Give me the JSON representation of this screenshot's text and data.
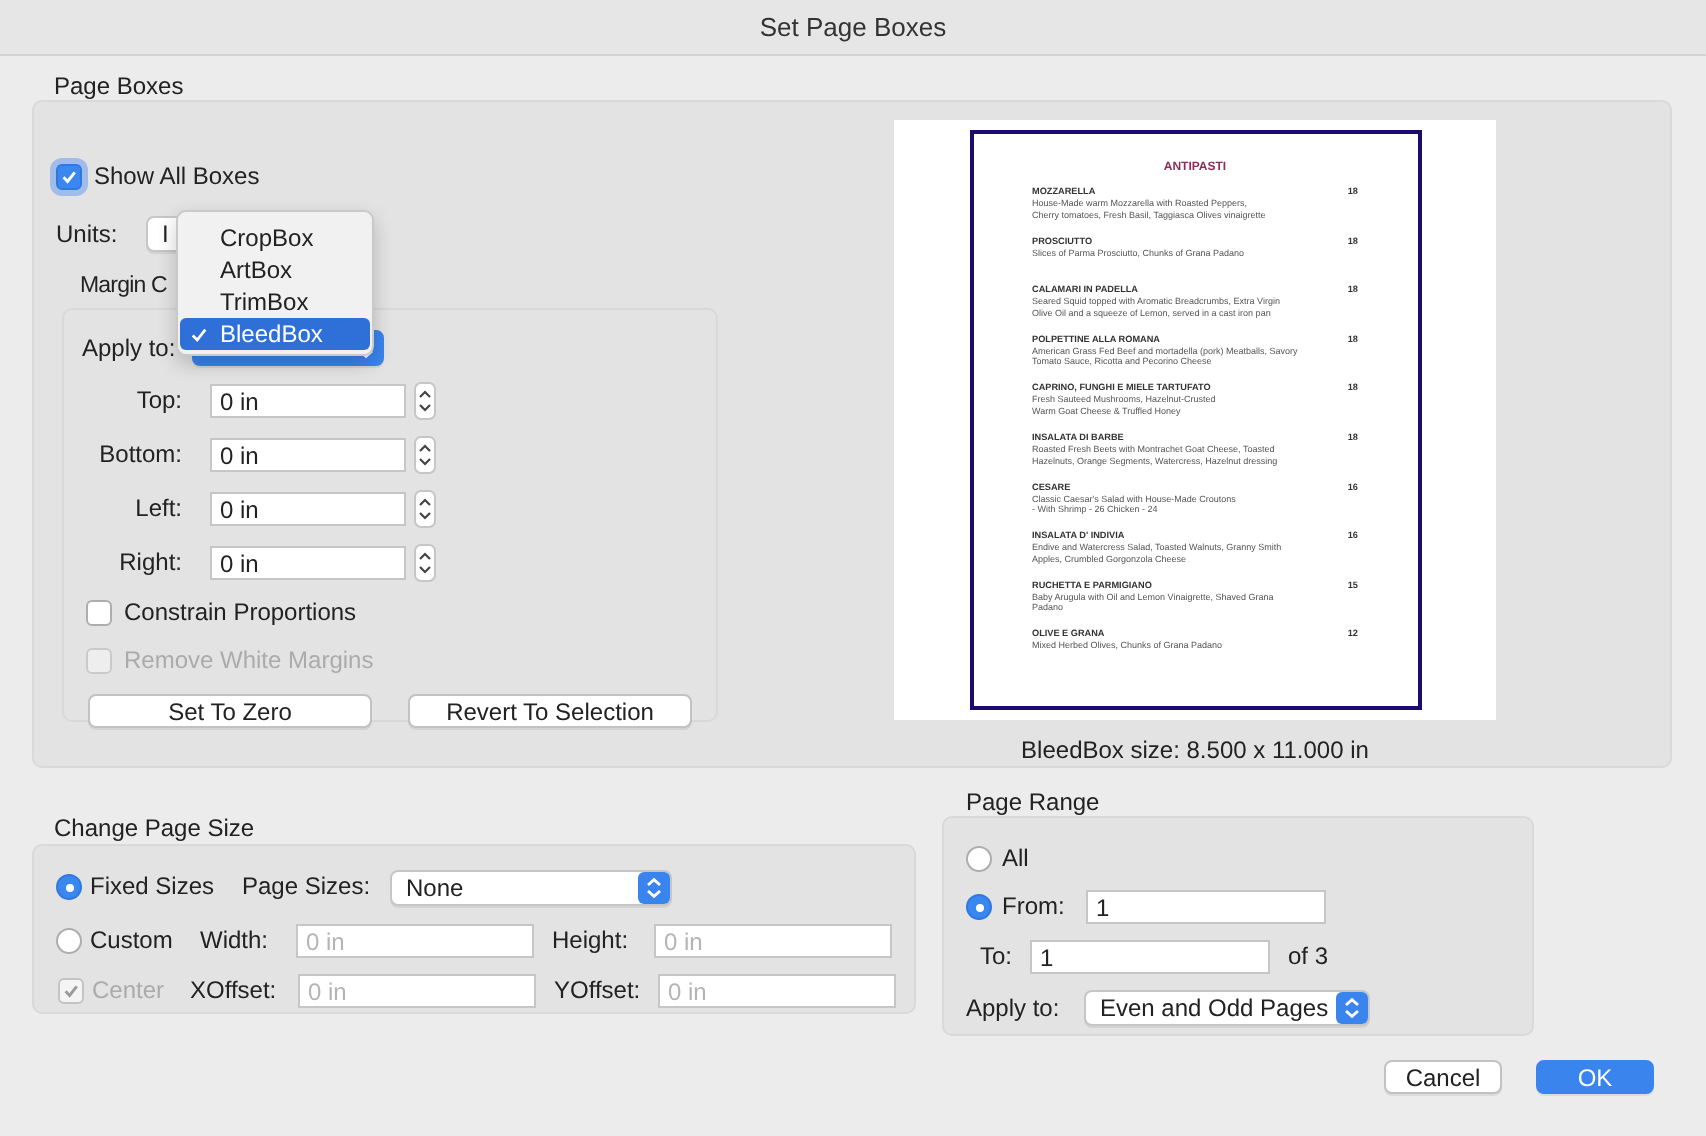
{
  "window": {
    "title": "Set Page Boxes"
  },
  "page_boxes": {
    "label": "Page Boxes",
    "show_all_boxes": {
      "label": "Show All Boxes",
      "checked": true
    },
    "units": {
      "label": "Units:",
      "value": "I"
    },
    "box_menu": {
      "items": [
        {
          "label": "CropBox",
          "selected": false
        },
        {
          "label": "ArtBox",
          "selected": false
        },
        {
          "label": "TrimBox",
          "selected": false
        },
        {
          "label": "BleedBox",
          "selected": true
        }
      ]
    },
    "margin_controls": {
      "label": "Margin C",
      "apply_to_label": "Apply to:",
      "fields": [
        {
          "label": "Top:",
          "value": "0 in"
        },
        {
          "label": "Bottom:",
          "value": "0 in"
        },
        {
          "label": "Left:",
          "value": "0 in"
        },
        {
          "label": "Right:",
          "value": "0 in"
        }
      ],
      "constrain_proportions": {
        "label": "Constrain Proportions",
        "checked": false,
        "disabled": false
      },
      "remove_white_margins": {
        "label": "Remove White Margins",
        "checked": false,
        "disabled": true
      },
      "buttons": [
        "Set To Zero",
        "Revert To Selection"
      ]
    },
    "preview": {
      "heading": "ANTIPASTI",
      "items": [
        {
          "name": "MOZZARELLA",
          "price": "18",
          "description": [
            "House-Made warm Mozzarella with Roasted Peppers,",
            "Cherry tomatoes, Fresh Basil, Taggiasca Olives vinaigrette"
          ]
        },
        {
          "name": "PROSCIUTTO",
          "price": "18",
          "description": [
            "Slices of Parma Prosciutto, Chunks of Grana Padano"
          ]
        },
        {
          "name": "CALAMARI IN PADELLA",
          "price": "18",
          "description": [
            "Seared Squid topped with Aromatic Breadcrumbs, Extra Virgin",
            "Olive Oil and a squeeze of Lemon, served in a cast iron pan"
          ]
        },
        {
          "name": "POLPETTINE ALLA ROMANA",
          "price": "18",
          "description": [
            "American Grass Fed Beef and mortadella (pork) Meatballs, Savory",
            "Tomato Sauce, Ricotta and Pecorino Cheese"
          ]
        },
        {
          "name": "CAPRINO, FUNGHI E MIELE TARTUFATO",
          "price": "18",
          "description": [
            "Fresh Sauteed Mushrooms, Hazelnut-Crusted",
            "Warm Goat Cheese & Truffled Honey"
          ]
        },
        {
          "name": "INSALATA DI BARBE",
          "price": "18",
          "description": [
            "Roasted Fresh Beets with Montrachet Goat Cheese, Toasted",
            "Hazelnuts, Orange Segments, Watercress, Hazelnut dressing"
          ]
        },
        {
          "name": "CESARE",
          "price": "16",
          "description": [
            "Classic Caesar's Salad with House-Made Croutons",
            "- With Shrimp - 26     Chicken - 24"
          ]
        },
        {
          "name": "INSALATA D' INDIVIA",
          "price": "16",
          "description": [
            "Endive and Watercress Salad, Toasted Walnuts, Granny Smith",
            "Apples, Crumbled Gorgonzola Cheese"
          ]
        },
        {
          "name": "RUCHETTA E PARMIGIANO",
          "price": "15",
          "description": [
            "Baby Arugula with Oil and Lemon Vinaigrette, Shaved Grana",
            "Padano"
          ]
        },
        {
          "name": "OLIVE E GRANA",
          "price": "12",
          "description": [
            "Mixed Herbed Olives, Chunks of Grana Padano"
          ]
        }
      ]
    },
    "size_caption": "BleedBox size: 8.500 x 11.000 in"
  },
  "change_page_size": {
    "label": "Change Page Size",
    "options": [
      {
        "label": "Fixed Sizes",
        "selected": true
      },
      {
        "label": "Custom",
        "selected": false
      }
    ],
    "page_sizes": {
      "label": "Page Sizes:",
      "value": "None"
    },
    "width": {
      "label": "Width:",
      "placeholder": "0 in"
    },
    "height": {
      "label": "Height:",
      "placeholder": "0 in"
    },
    "center": {
      "label": "Center",
      "checked": true,
      "disabled": true
    },
    "xoffset": {
      "label": "XOffset:",
      "placeholder": "0 in"
    },
    "yoffset": {
      "label": "YOffset:",
      "placeholder": "0 in"
    }
  },
  "page_range": {
    "label": "Page Range",
    "options": [
      {
        "label": "All",
        "selected": false
      },
      {
        "label": "From:",
        "selected": true
      }
    ],
    "from": {
      "value": "1"
    },
    "to": {
      "label": "To:",
      "value": "1"
    },
    "of_total": "of 3",
    "apply_to": {
      "label": "Apply to:",
      "value": "Even and Odd Pages"
    }
  },
  "buttons": [
    {
      "label": "Cancel",
      "kind": "secondary"
    },
    {
      "label": "OK",
      "kind": "default"
    }
  ]
}
